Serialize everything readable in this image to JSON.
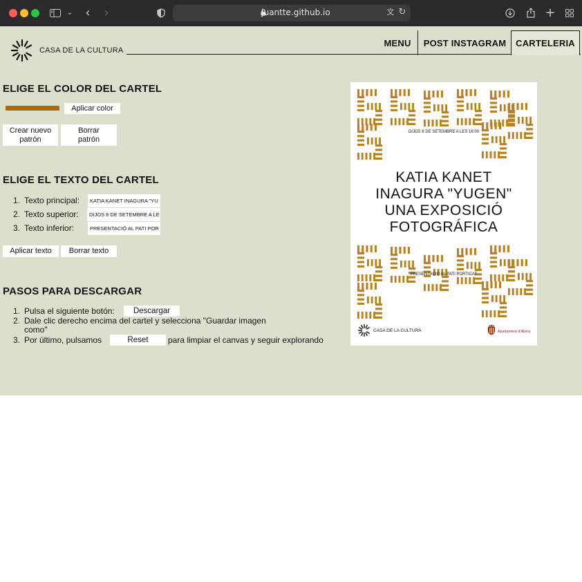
{
  "browser": {
    "url": "juantte.github.io"
  },
  "header": {
    "brand": "CASA DE LA CULTURA",
    "nav": [
      "MENU",
      "POST INSTAGRAM",
      "CARTELERIA"
    ]
  },
  "color_section": {
    "title": "ELIGE EL COLOR DEL CARTEL",
    "swatch_color": "#a86a0c",
    "apply_label": "Aplicar color",
    "new_pattern_label": "Crear nuevo patrón",
    "delete_pattern_label": "Borrar patrón"
  },
  "text_section": {
    "title": "ELIGE EL TEXTO DEL CARTEL",
    "fields": [
      {
        "num": "1.",
        "label": "Texto principal:",
        "value": "KATIA KANET INAGURA \"YU"
      },
      {
        "num": "2.",
        "label": "Texto superior:",
        "value": "DIJOS 8 DE SETEMBRE A LE"
      },
      {
        "num": "3.",
        "label": "Texto inferior:",
        "value": "PRESENTACIÓ AL PATI POR"
      }
    ],
    "apply_label": "Aplicar texto",
    "delete_label": "Borrar texto"
  },
  "download_section": {
    "title": "PASOS PARA DESCARGAR",
    "step1_num": "1.",
    "step1_text": "Pulsa el siguiente botón:",
    "download_label": "Descargar",
    "step2_num": "2.",
    "step2_text": "Dale clic derecho encima del cartel y selecciona \"Guardar imagen como\"",
    "step3_num": "3.",
    "step3_pre": "Por último, pulsamos",
    "reset_label": "Reset",
    "step3_post": "para limpiar el canvas y seguir explorando"
  },
  "poster": {
    "accent_color": "#b8801e",
    "top_text": "DIJOS 8 DE SETEMBRE A LES 16:00",
    "title_lines": [
      "KATIA KANET",
      "INAGURA \"YUGEN\"",
      "UNA EXPOSICIÓ",
      "FOTOGRÁFICA"
    ],
    "bottom_text": "PRESENTACIÓ AL PATI PORTICAT",
    "brand": "CASA DE LA CULTURA",
    "sponsor": "Ajuntament d'Alzira"
  }
}
